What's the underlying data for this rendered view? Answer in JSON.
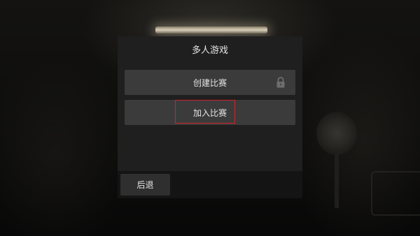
{
  "menu": {
    "title": "多人游戏",
    "create_label": "创建比赛",
    "create_locked": true,
    "join_label": "加入比赛",
    "back_label": "后退",
    "focused_item": "join"
  },
  "icons": {
    "lock": "lock-icon"
  },
  "colors": {
    "panel_bg": "#1f1f1f",
    "button_bg": "#3b3b3b",
    "focus_outline": "#d3222a",
    "text": "#e6e6e6"
  }
}
